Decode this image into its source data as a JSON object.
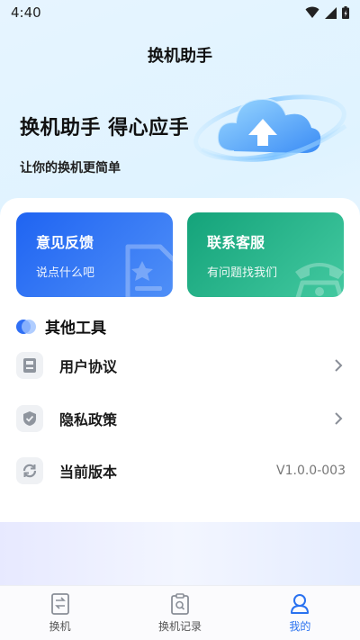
{
  "status_bar": {
    "time": "4:40"
  },
  "nav": {
    "title": "换机助手"
  },
  "hero": {
    "title": "换机助手 得心应手",
    "subtitle": "让你的换机更简单"
  },
  "cards": {
    "feedback": {
      "title": "意见反馈",
      "desc": "说点什么吧"
    },
    "service": {
      "title": "联系客服",
      "desc": "有问题找我们"
    }
  },
  "section": {
    "title": "其他工具"
  },
  "menu": [
    {
      "label": "用户协议",
      "icon": "document-icon"
    },
    {
      "label": "隐私政策",
      "icon": "shield-icon"
    },
    {
      "label": "当前版本",
      "icon": "refresh-icon",
      "value": "V1.0.0-003"
    }
  ],
  "tabs": [
    {
      "label": "换机",
      "icon": "phone-swap-icon"
    },
    {
      "label": "换机记录",
      "icon": "record-icon"
    },
    {
      "label": "我的",
      "icon": "user-icon",
      "active": true
    }
  ],
  "colors": {
    "accent": "#2a72f0",
    "feedback_card": "#1f64f2",
    "service_card": "#14a37a"
  }
}
